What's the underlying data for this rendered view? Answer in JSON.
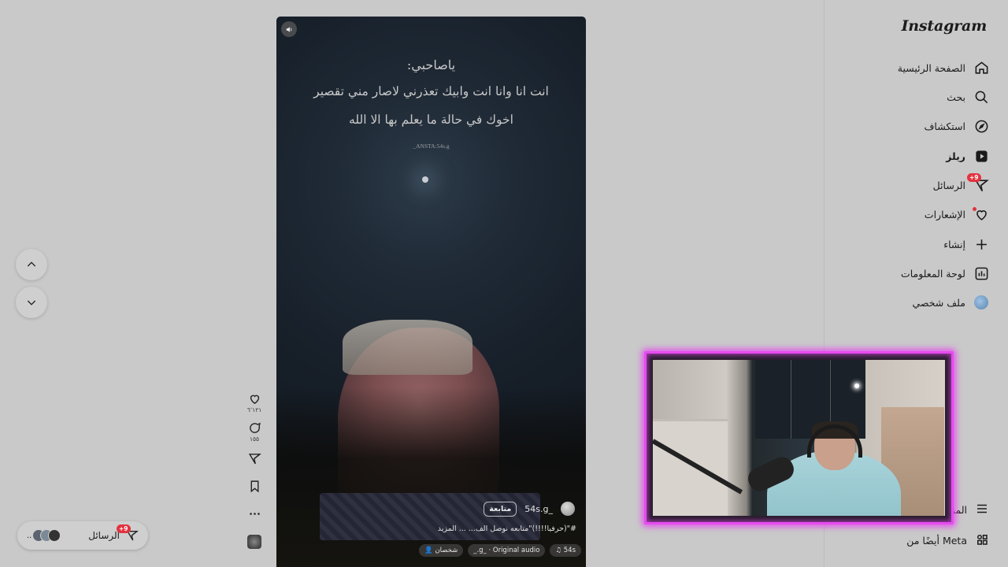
{
  "app": {
    "logo": "Instagram"
  },
  "sidebar": {
    "items": [
      {
        "label": "الصفحة الرئيسية",
        "icon": "home-icon"
      },
      {
        "label": "بحث",
        "icon": "search-icon"
      },
      {
        "label": "استكشاف",
        "icon": "compass-icon"
      },
      {
        "label": "ريلز",
        "icon": "reels-icon",
        "active": true
      },
      {
        "label": "الرسائل",
        "icon": "messages-icon",
        "badge": "+9"
      },
      {
        "label": "الإشعارات",
        "icon": "heart-icon"
      },
      {
        "label": "إنشاء",
        "icon": "plus-icon"
      },
      {
        "label": "لوحة المعلومات",
        "icon": "dashboard-icon"
      },
      {
        "label": "ملف شخصي",
        "icon": "avatar"
      }
    ],
    "more_label": "المزيد",
    "meta_label": "أيضًا من Meta"
  },
  "reel": {
    "quote_line1": "ياصاحبي:",
    "quote_line2": "انت انا وانا انت وابيك تعذرني لاصار مني تقصير",
    "quote_line3": "اخوك في حالة ما يعلم بها الا الله",
    "signature": "ANSTA:54s.g_",
    "username": "54s.g_",
    "follow_label": "متابعة",
    "caption": "#\"(حرفيا!!!!)\"متابعه نوصل الف... ... المزيد",
    "audio_user": "54s",
    "audio_label": "_.g_ · Original audio",
    "people_label": "شخصان"
  },
  "actions": {
    "likes": "٦٬١٢١",
    "comments": "١٥٥"
  },
  "messages_bubble": {
    "label": "الرسائل",
    "badge": "+9",
    "more": "..."
  },
  "colors": {
    "accent_badge": "#e2323f",
    "cam_border": "#e64bf0"
  }
}
